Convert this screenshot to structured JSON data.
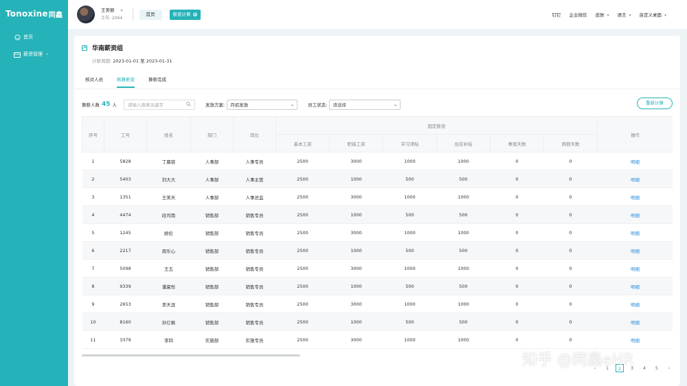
{
  "brand": {
    "logo_en": "Tonoxine",
    "logo_cn": "同鑫"
  },
  "sidebar": {
    "items": [
      {
        "label": "首页",
        "icon": "home-icon"
      },
      {
        "label": "薪资管理",
        "icon": "wallet-icon"
      }
    ]
  },
  "header": {
    "user_name": "王美丽",
    "user_id": "工号: 2064",
    "tab_home": "首页",
    "tab_active": "薪资计算",
    "right": [
      "钉钉",
      "企业微信",
      "皮肤",
      "语言",
      "自定义桌面"
    ]
  },
  "card": {
    "title": "华南薪资组",
    "period_label": "计薪周期:",
    "period_value": "2023-01-01 至 2023-01-31",
    "tabs": [
      "核对人员",
      "核算薪资",
      "算薪完成"
    ],
    "active_tab": 1
  },
  "filters": {
    "count_label": "算薪人数",
    "count_value": "45",
    "count_unit": "人",
    "search_placeholder": "请输入搜索关键字",
    "plan_label": "发放方案:",
    "plan_value": "月初发放",
    "status_label": "员工状态:",
    "status_value": "请选择",
    "recalc_label": "重新计算"
  },
  "table": {
    "headers": [
      "序号",
      "工号",
      "姓名",
      "部门",
      "岗位",
      "固定薪资",
      "操作"
    ],
    "sub_headers": [
      "基本工资",
      "职级工资",
      "学习津贴",
      "住房补贴",
      "事假天数",
      "病假天数"
    ],
    "rows": [
      [
        "1",
        "5828",
        "丁晨容",
        "人事部",
        "人事专员",
        "2500",
        "3000",
        "1000",
        "1000",
        "0",
        "0",
        "明细"
      ],
      [
        "2",
        "5403",
        "刘大大",
        "人事部",
        "人事主管",
        "2500",
        "1000",
        "500",
        "500",
        "0",
        "0",
        "明细"
      ],
      [
        "3",
        "1351",
        "王笑天",
        "人事部",
        "人事总监",
        "2500",
        "3000",
        "1000",
        "1000",
        "0",
        "0",
        "明细"
      ],
      [
        "4",
        "4474",
        "段司南",
        "销售部",
        "销售专员",
        "2500",
        "1000",
        "500",
        "500",
        "0",
        "0",
        "明细"
      ],
      [
        "5",
        "1245",
        "顾伦",
        "销售部",
        "销售专员",
        "2500",
        "3000",
        "1000",
        "1000",
        "0",
        "0",
        "明细"
      ],
      [
        "6",
        "2217",
        "周乐心",
        "销售部",
        "销售专员",
        "2500",
        "1000",
        "500",
        "500",
        "0",
        "0",
        "明细"
      ],
      [
        "7",
        "5098",
        "王五",
        "销售部",
        "销售专员",
        "2500",
        "3000",
        "1000",
        "1000",
        "0",
        "0",
        "明细"
      ],
      [
        "8",
        "9339",
        "潘夏彤",
        "销售部",
        "销售专员",
        "2500",
        "1000",
        "500",
        "500",
        "0",
        "0",
        "明细"
      ],
      [
        "9",
        "2653",
        "李天涯",
        "销售部",
        "销售专员",
        "2500",
        "3000",
        "1000",
        "1000",
        "0",
        "0",
        "明细"
      ],
      [
        "10",
        "8160",
        "孙亿枫",
        "销售部",
        "销售专员",
        "2500",
        "1000",
        "500",
        "500",
        "0",
        "0",
        "明细"
      ],
      [
        "11",
        "3379",
        "李四",
        "实施部",
        "实施专员",
        "2500",
        "3000",
        "1000",
        "1000",
        "0",
        "0",
        "明细"
      ]
    ]
  },
  "pager": {
    "pages": [
      "1",
      "2",
      "3",
      "4",
      "5"
    ],
    "current": "2"
  },
  "watermark": "知乎 @同鑫eHR",
  "colors": {
    "accent": "#25b2b8",
    "link": "#2f8fd8"
  }
}
